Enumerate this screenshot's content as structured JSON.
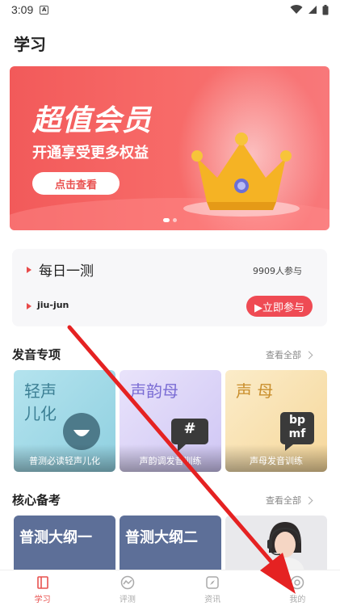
{
  "status_bar": {
    "time": "3:09"
  },
  "page": {
    "title": "学习"
  },
  "banner": {
    "title": "超值会员",
    "subtitle": "开通享受更多权益",
    "button": "点击查看"
  },
  "daily": {
    "title": "每日一测",
    "count": "9909人参与",
    "word": "jiu-jun",
    "button": "▶立即参与"
  },
  "pronunciation": {
    "title": "发音专项",
    "more": "查看全部",
    "cards": [
      {
        "big_line1": "轻声",
        "big_line2": "儿化",
        "caption": "普测必读轻声儿化"
      },
      {
        "big_line1": "声韵母",
        "badge": "#",
        "caption": "声韵调发音训练"
      },
      {
        "big_line1": "声 母",
        "badge_line1": "bp",
        "badge_line2": "mf",
        "caption": "声母发音训练"
      }
    ]
  },
  "exam": {
    "title": "核心备考",
    "more": "查看全部",
    "cards": [
      {
        "label": "普测大纲一"
      },
      {
        "label": "普测大纲二"
      }
    ]
  },
  "tabs": [
    {
      "label": "学习",
      "icon": "book-icon",
      "active": true
    },
    {
      "label": "评测",
      "icon": "chart-icon",
      "active": false
    },
    {
      "label": "资讯",
      "icon": "compass-icon",
      "active": false
    },
    {
      "label": "我的",
      "icon": "profile-icon",
      "active": false
    }
  ],
  "colors": {
    "accent": "#e8524f",
    "banner": "#f25a5a",
    "exam_card": "#5d6f98"
  }
}
